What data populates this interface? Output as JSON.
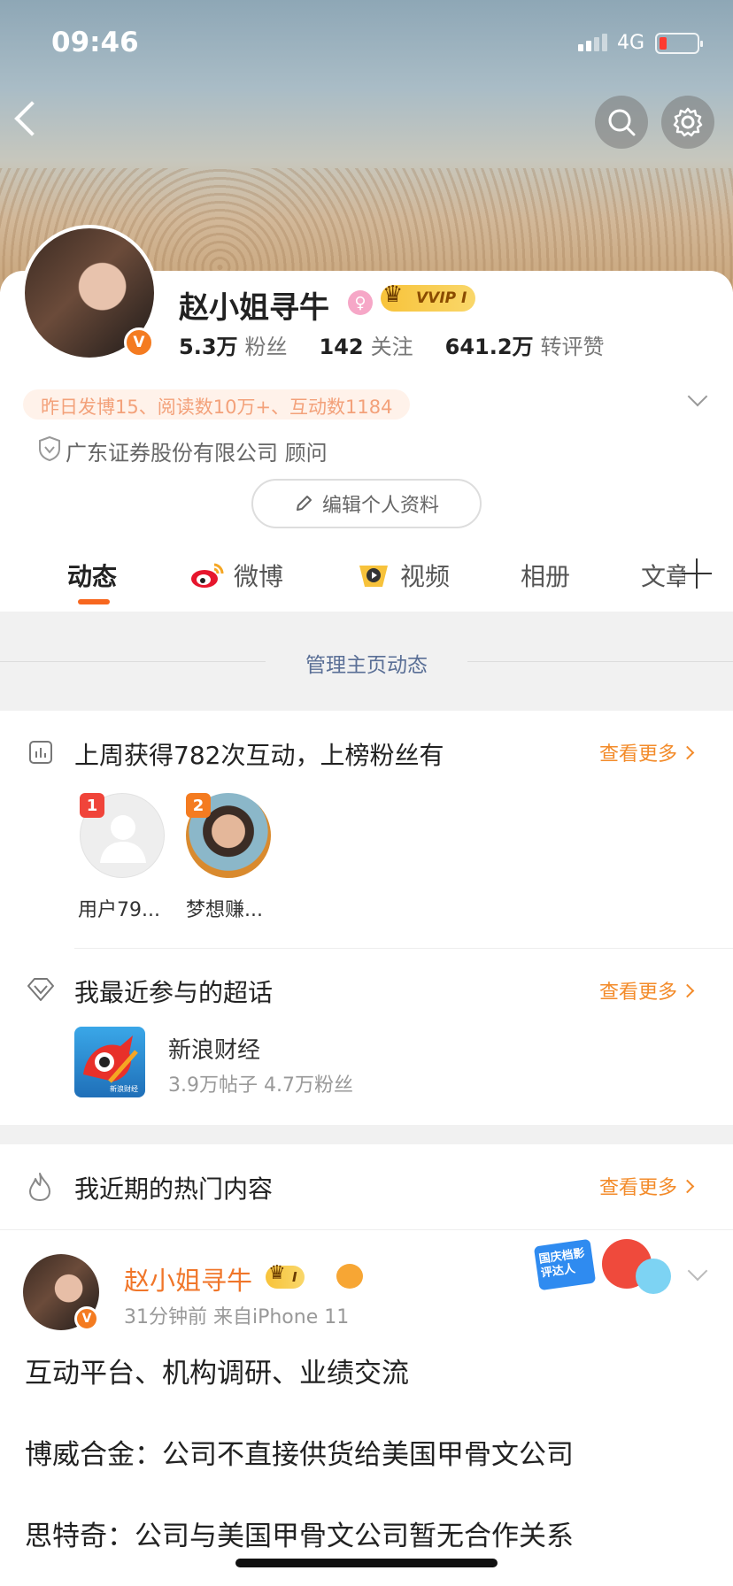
{
  "status_bar": {
    "time": "09:46",
    "network": "4G"
  },
  "profile": {
    "name": "赵小姐寻牛",
    "vip_label": "VVIP",
    "vip_level": "I",
    "verified_badge": "V",
    "stats": [
      {
        "value": "5.3万",
        "label": "粉丝"
      },
      {
        "value": "142",
        "label": "关注"
      },
      {
        "value": "641.2万",
        "label": "转评赞"
      }
    ],
    "summary": "昨日发博15、阅读数10万+、互动数1184",
    "company": "广东证券股份有限公司 顾问",
    "edit_button": "编辑个人资料"
  },
  "tabs": [
    {
      "label": "动态"
    },
    {
      "label": "微博"
    },
    {
      "label": "视频"
    },
    {
      "label": "相册"
    },
    {
      "label": "文章"
    }
  ],
  "manage": "管理主页动态",
  "interaction": {
    "title": "上周获得782次互动，上榜粉丝有",
    "more": "查看更多",
    "fans": [
      {
        "rank": "1",
        "name": "用户79..."
      },
      {
        "rank": "2",
        "name": "梦想赚..."
      }
    ]
  },
  "supertopic": {
    "title": "我最近参与的超话",
    "more": "查看更多",
    "item": {
      "name": "新浪财经",
      "stats": "3.9万帖子 4.7万粉丝",
      "icon_text": "新浪财经"
    }
  },
  "hot": {
    "title": "我近期的热门内容",
    "more": "查看更多"
  },
  "post": {
    "author": "赵小姐寻牛",
    "level": "I",
    "meta": "31分钟前  来自iPhone 11",
    "badge_text": "国庆档影评达人",
    "lines": [
      "互动平台、机构调研、业绩交流",
      "博威合金：公司不直接供货给美国甲骨文公司",
      "思特奇：公司与美国甲骨文公司暂无合作关系"
    ]
  },
  "colors": {
    "accent": "#f7671f",
    "more": "#f38b2a",
    "link": "#5a6f96"
  }
}
